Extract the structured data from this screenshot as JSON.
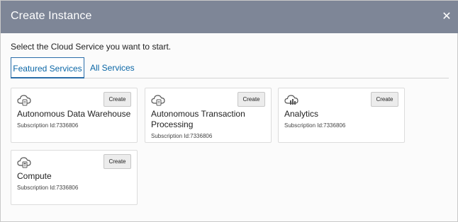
{
  "dialog": {
    "title": "Create Instance",
    "close_icon": "close-icon",
    "instruction": "Select the Cloud Service you want to start."
  },
  "tabs": [
    {
      "label": "Featured Services",
      "active": true
    },
    {
      "label": "All Services",
      "active": false
    }
  ],
  "cards": [
    {
      "title": "Autonomous Data Warehouse",
      "subscription": "Subscription Id:7336806",
      "button": "Create",
      "icon": "cloud-database-icon"
    },
    {
      "title": "Autonomous Transaction Processing",
      "subscription": "Subscription Id:7336806",
      "button": "Create",
      "icon": "cloud-database-icon"
    },
    {
      "title": "Analytics",
      "subscription": "Subscription Id:7336806",
      "button": "Create",
      "icon": "cloud-analytics-icon"
    },
    {
      "title": "Compute",
      "subscription": "Subscription Id:7336806",
      "button": "Create",
      "icon": "cloud-compute-icon"
    }
  ],
  "colors": {
    "header_bg": "#7e8697",
    "accent": "#0a66a6"
  }
}
